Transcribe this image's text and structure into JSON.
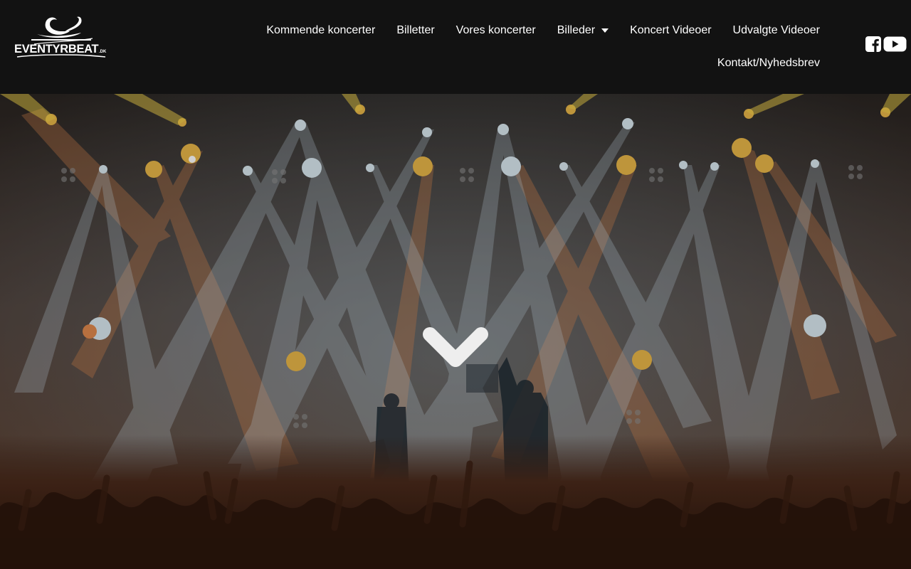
{
  "site": {
    "logo_text": "EVENTYRBEAT.DK",
    "logo_icon": "swan-logo-icon"
  },
  "nav": {
    "items": [
      {
        "label": "Kommende koncerter",
        "has_dropdown": false
      },
      {
        "label": "Billetter",
        "has_dropdown": false
      },
      {
        "label": "Vores koncerter",
        "has_dropdown": false
      },
      {
        "label": "Billeder",
        "has_dropdown": true
      },
      {
        "label": "Koncert Videoer",
        "has_dropdown": false
      },
      {
        "label": "Udvalgte Videoer",
        "has_dropdown": false
      },
      {
        "label": "Kontakt/Nyhedsbrev",
        "has_dropdown": false
      }
    ]
  },
  "social": {
    "icons": [
      "facebook-icon",
      "youtube-icon"
    ]
  },
  "hero": {
    "scroll_icon": "chevron-down-icon"
  },
  "colors": {
    "header_bg": "#121212",
    "text": "#ffffff",
    "beam_blue": "#a9c8dc",
    "beam_orange": "#e0894e"
  }
}
